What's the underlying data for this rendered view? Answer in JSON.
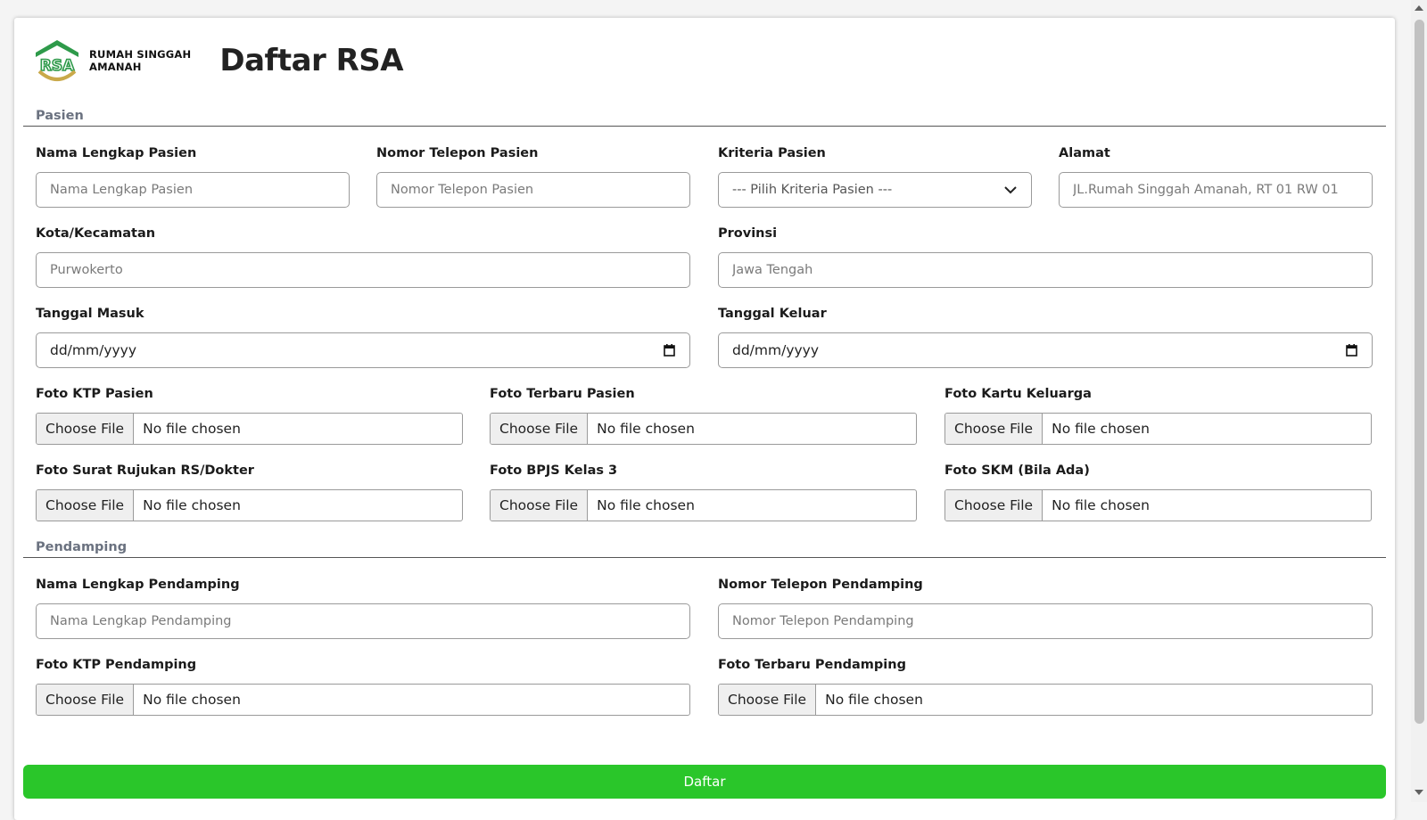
{
  "header": {
    "logo_line1": "RUMAH SINGGAH",
    "logo_line2": "AMANAH",
    "title": "Daftar RSA"
  },
  "colors": {
    "brand_green": "#2e9a4a",
    "logo_gold": "#c9a94a",
    "submit_green": "#2ac62a"
  },
  "sections": {
    "pasien": "Pasien",
    "pendamping": "Pendamping"
  },
  "pasien": {
    "nama": {
      "label": "Nama Lengkap Pasien",
      "placeholder": "Nama Lengkap Pasien"
    },
    "telepon": {
      "label": "Nomor Telepon Pasien",
      "placeholder": "Nomor Telepon Pasien"
    },
    "kriteria": {
      "label": "Kriteria Pasien",
      "selected": "--- Pilih Kriteria Pasien ---"
    },
    "alamat": {
      "label": "Alamat",
      "placeholder": "JL.Rumah Singgah Amanah, RT 01 RW 01"
    },
    "kota": {
      "label": "Kota/Kecamatan",
      "placeholder": "Purwokerto"
    },
    "provinsi": {
      "label": "Provinsi",
      "placeholder": "Jawa Tengah"
    },
    "tanggal_masuk": {
      "label": "Tanggal Masuk",
      "value": "dd/mm/yyyy"
    },
    "tanggal_keluar": {
      "label": "Tanggal Keluar",
      "value": "dd/mm/yyyy"
    },
    "files": [
      {
        "label": "Foto KTP Pasien"
      },
      {
        "label": "Foto Terbaru Pasien"
      },
      {
        "label": "Foto Kartu Keluarga"
      },
      {
        "label": "Foto Surat Rujukan RS/Dokter"
      },
      {
        "label": "Foto BPJS Kelas 3"
      },
      {
        "label": "Foto SKM (Bila Ada)"
      }
    ]
  },
  "pendamping": {
    "nama": {
      "label": "Nama Lengkap Pendamping",
      "placeholder": "Nama Lengkap Pendamping"
    },
    "telepon": {
      "label": "Nomor Telepon Pendamping",
      "placeholder": "Nomor Telepon Pendamping"
    },
    "files": [
      {
        "label": "Foto KTP Pendamping"
      },
      {
        "label": "Foto Terbaru Pendamping"
      }
    ]
  },
  "file_input": {
    "button": "Choose File",
    "status": "No file chosen"
  },
  "submit_label": "Daftar"
}
